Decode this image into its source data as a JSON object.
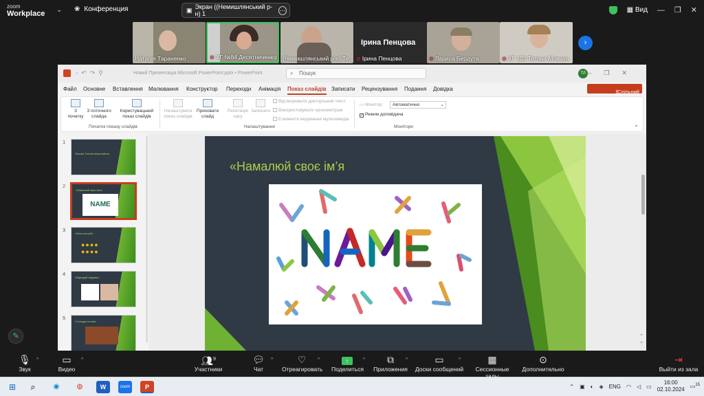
{
  "zoom": {
    "logo_top": "zoom",
    "logo_bottom": "Workplace",
    "conference_label": "Конференция",
    "share_label": "Экран ((Немишлянський р-н) 1",
    "view_label": "Вид"
  },
  "participants": [
    {
      "name": "Наталія Тараненко",
      "muted": false
    },
    {
      "name": "ХГ №84 Десятниченко Д...",
      "muted": true
    },
    {
      "name": "(Немишлянський р-н) Те...",
      "muted": false
    },
    {
      "name": "Ірина Пенцова",
      "muted": true,
      "big_name": "Ірина Пенцова"
    },
    {
      "name": "Лариса Бердута",
      "muted": true
    },
    {
      "name": "ХГ 123 Тетяна Мовчан",
      "muted": true
    }
  ],
  "ppt": {
    "file_title": "Новий Презентація Microsoft PowerPoint.pptx  •  PowerPoint",
    "search_placeholder": "Пошук",
    "avatar": "ТЛ",
    "share_button": "Спільний доступ",
    "menu": [
      "Файл",
      "Основне",
      "Вставлення",
      "Малювання",
      "Конструктор",
      "Переходи",
      "Анімація",
      "Показ слайдів",
      "Записати",
      "Рецензування",
      "Подання",
      "Довідка"
    ],
    "active_menu": "Показ слайдів",
    "ribbon": {
      "from_start": "З початку",
      "from_current": "З поточного слайда",
      "custom_show": "Користувацький показ слайдів",
      "setup_show": "Налаштувати показ слайдів",
      "hide_slide": "Приховати слайд",
      "rehearse": "Репетиція часу",
      "record": "Записати",
      "cb_narrations": "Відтворювати дикторський текст",
      "cb_timings": "Використовувати хронометраж",
      "cb_media": "Елементи керування мультимедіа",
      "monitor_label": "Монітор:",
      "monitor_value": "Автоматично",
      "presenter_view": "Режим доповідача",
      "group_start": "Початок показу слайдів",
      "group_setup": "Налаштування",
      "group_monitors": "Монітори"
    },
    "thumbnails": [
      {
        "num": "1",
        "text": "Лекова Тетяна Миколаївна"
      },
      {
        "num": "2",
        "text": "«Намалюй своє ім'я»"
      },
      {
        "num": "3",
        "text": "«Моя настрій»"
      },
      {
        "num": "4",
        "text": "«Відгадай видами»"
      },
      {
        "num": "5",
        "text": "«Складні слова»"
      }
    ],
    "selected_slide": "2",
    "slide_title": "«Намалюй своє ім’я",
    "slide_word": "NAME"
  },
  "toolbar": {
    "audio": "Звук",
    "video": "Видео",
    "participants": "Участники",
    "participants_count": "9",
    "chat": "Чат",
    "react": "Отреагировать",
    "share": "Поделиться",
    "apps": "Приложения",
    "whiteboards": "Доски сообщений",
    "breakout": "Сессионные залы",
    "more": "Дополнительно",
    "leave": "Выйти из зала"
  },
  "taskbar": {
    "lang": "ENG",
    "time": "16:00",
    "date": "02.10.2024",
    "notif": "15"
  }
}
